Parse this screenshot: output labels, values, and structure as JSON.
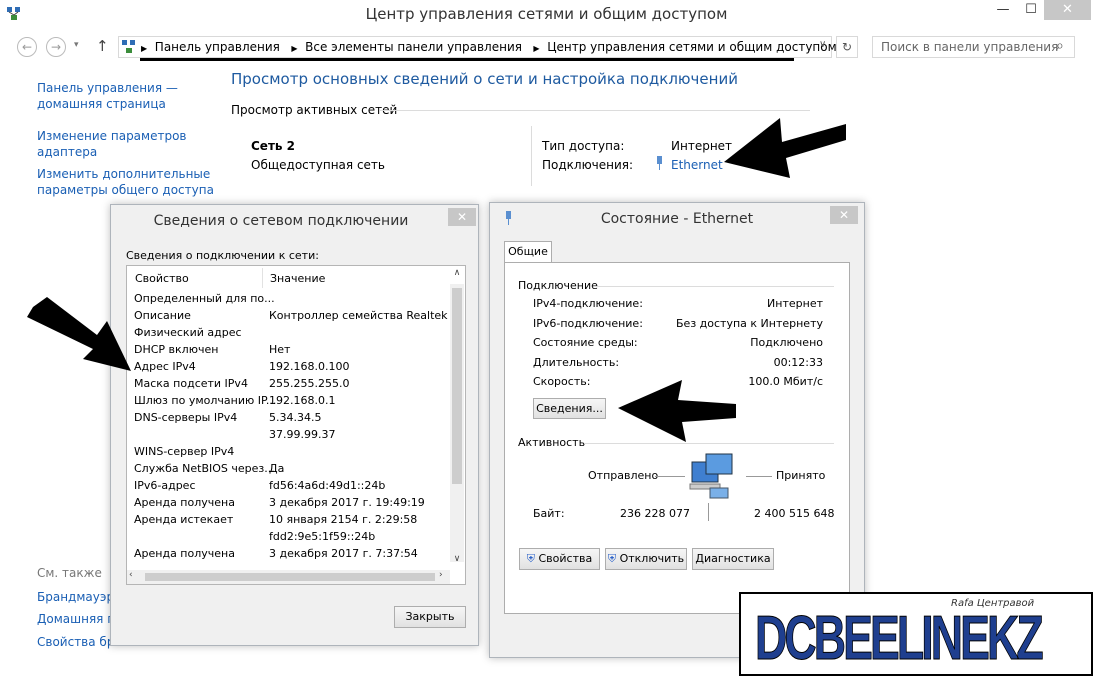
{
  "window": {
    "title": "Центр управления сетями и общим доступом",
    "min": "—",
    "max": "☐",
    "close": "✕"
  },
  "address": {
    "crumbs": [
      "Панель управления",
      "Все элементы панели управления",
      "Центр управления сетями и общим доступом"
    ],
    "search_placeholder": "Поиск в панели управления"
  },
  "sidebar": {
    "home_line1": "Панель управления —",
    "home_line2": "домашняя страница",
    "adapter_line1": "Изменение параметров",
    "adapter_line2": "адаптера",
    "sharing_line1": "Изменить дополнительные",
    "sharing_line2": "параметры общего доступа",
    "see_also": "См. также",
    "firewall": "Брандмауэр W",
    "home_group": "Домашняя гр",
    "browser": "Свойства бра"
  },
  "main": {
    "heading": "Просмотр основных сведений о сети и настройка подключений",
    "active_networks": "Просмотр активных сетей",
    "network_name": "Сеть  2",
    "network_type": "Общедоступная сеть",
    "access_label": "Тип доступа:",
    "access_value": "Интернет",
    "connections_label": "Подключения:",
    "connections_value": "Ethernet"
  },
  "details": {
    "title": "Сведения о сетевом подключении",
    "caption": "Сведения о подключении к сети:",
    "col_property": "Свойство",
    "col_value": "Значение",
    "rows": [
      {
        "p": "Определенный для по...",
        "v": ""
      },
      {
        "p": "Описание",
        "v": "Контроллер семейства Realtek PCI"
      },
      {
        "p": "Физический адрес",
        "v": ""
      },
      {
        "p": "DHCP включен",
        "v": "Нет"
      },
      {
        "p": "Адрес IPv4",
        "v": "192.168.0.100"
      },
      {
        "p": "Маска подсети IPv4",
        "v": "255.255.255.0"
      },
      {
        "p": "Шлюз по умолчанию IP...",
        "v": "192.168.0.1"
      },
      {
        "p": "DNS-серверы IPv4",
        "v": "5.34.34.5"
      },
      {
        "p": "",
        "v": "37.99.99.37"
      },
      {
        "p": "WINS-сервер IPv4",
        "v": ""
      },
      {
        "p": "Служба NetBIOS через...",
        "v": "Да"
      },
      {
        "p": "IPv6-адрес",
        "v": "fd56:4a6d:49d1::24b"
      },
      {
        "p": "Аренда получена",
        "v": "3 декабря 2017 г. 19:49:19"
      },
      {
        "p": "Аренда истекает",
        "v": "10 января 2154 г. 2:29:58"
      },
      {
        "p": "",
        "v": "fdd2:9e5:1f59::24b"
      },
      {
        "p": "Аренда получена",
        "v": "3 декабря 2017 г. 7:37:54"
      }
    ],
    "close_button": "Закрыть"
  },
  "status": {
    "title": "Состояние - Ethernet",
    "tab": "Общие",
    "connection_group": "Подключение",
    "items": [
      {
        "label": "IPv4-подключение:",
        "value": "Интернет"
      },
      {
        "label": "IPv6-подключение:",
        "value": "Без доступа к Интернету"
      },
      {
        "label": "Состояние среды:",
        "value": "Подключено"
      },
      {
        "label": "Длительность:",
        "value": "00:12:33"
      },
      {
        "label": "Скорость:",
        "value": "100.0 Мбит/с"
      }
    ],
    "details_button": "Сведения...",
    "activity_group": "Активность",
    "sent": "Отправлено",
    "received": "Принято",
    "bytes_label": "Байт:",
    "bytes_sent": "236 228 077",
    "bytes_received": "2 400 515 648",
    "properties_button": "Свойства",
    "disable_button": "Отключить",
    "diagnose_button": "Диагностика"
  },
  "watermark": {
    "brand": "DCBEELINEKZ",
    "signature": "Rafa Центравой"
  },
  "colors": {
    "link": "#1a5fb4",
    "heading": "#1e5aa0",
    "logo_blue": "#1f3f8f",
    "logo_orange": "#f4a81d"
  }
}
